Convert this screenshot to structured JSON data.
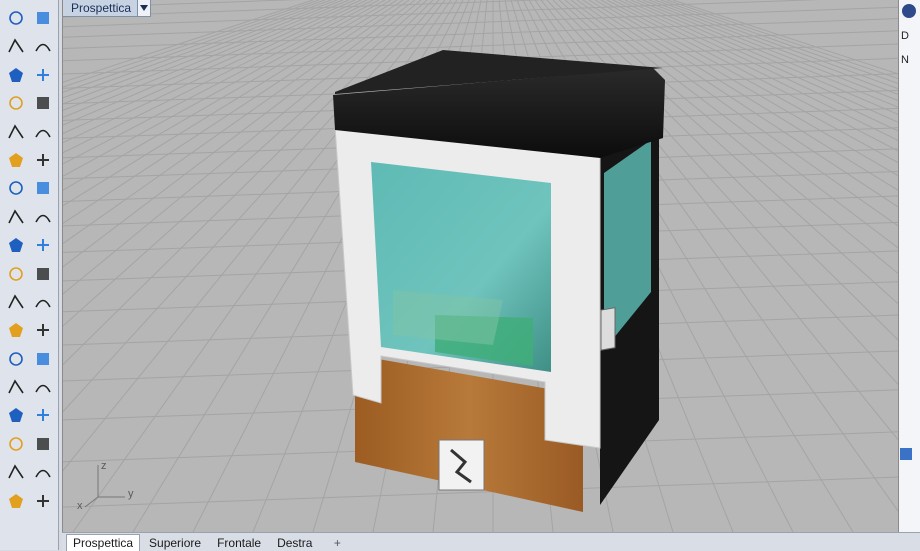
{
  "viewport": {
    "title": "Prospettica",
    "axes": {
      "x": "x",
      "y": "y",
      "z": "z"
    }
  },
  "tabs": [
    {
      "label": "Prospettica",
      "active": true
    },
    {
      "label": "Superiore",
      "active": false
    },
    {
      "label": "Frontale",
      "active": false
    },
    {
      "label": "Destra",
      "active": false
    }
  ],
  "add_tab_glyph": "+",
  "right_panel": {
    "letter_1": "D",
    "letter_2": "N"
  },
  "toolbar_icons": [
    "select-arrow-icon",
    "point-icon",
    "polyline-icon",
    "curve-icon",
    "circle-icon",
    "ellipse-icon",
    "arc-icon",
    "rectangle-icon",
    "polygon-icon",
    "fillet-curve-icon",
    "freeform-surface-icon",
    "loft-icon",
    "box-solid-icon",
    "sphere-solid-icon",
    "cylinder-solid-icon",
    "plane-surface-icon",
    "gear-tool-icon",
    "explode-icon",
    "trim-icon",
    "split-icon",
    "boolean-icon",
    "point-cloud-icon",
    "offset-icon",
    "blend-icon",
    "text-icon",
    "dimension-icon",
    "group-icon",
    "align-icon",
    "block-icon",
    "hatch-icon",
    "array-icon",
    "transform-icon",
    "analyze-icon",
    "check-icon",
    "render-icon",
    "material-icon"
  ],
  "colors": {
    "grid_bg": "#b7b7b7",
    "grid_line": "#a4a4a4",
    "frame_white": "#ececec",
    "top_black": "#141414",
    "wood": "#a8682c",
    "glass": "#5fb3b0"
  }
}
